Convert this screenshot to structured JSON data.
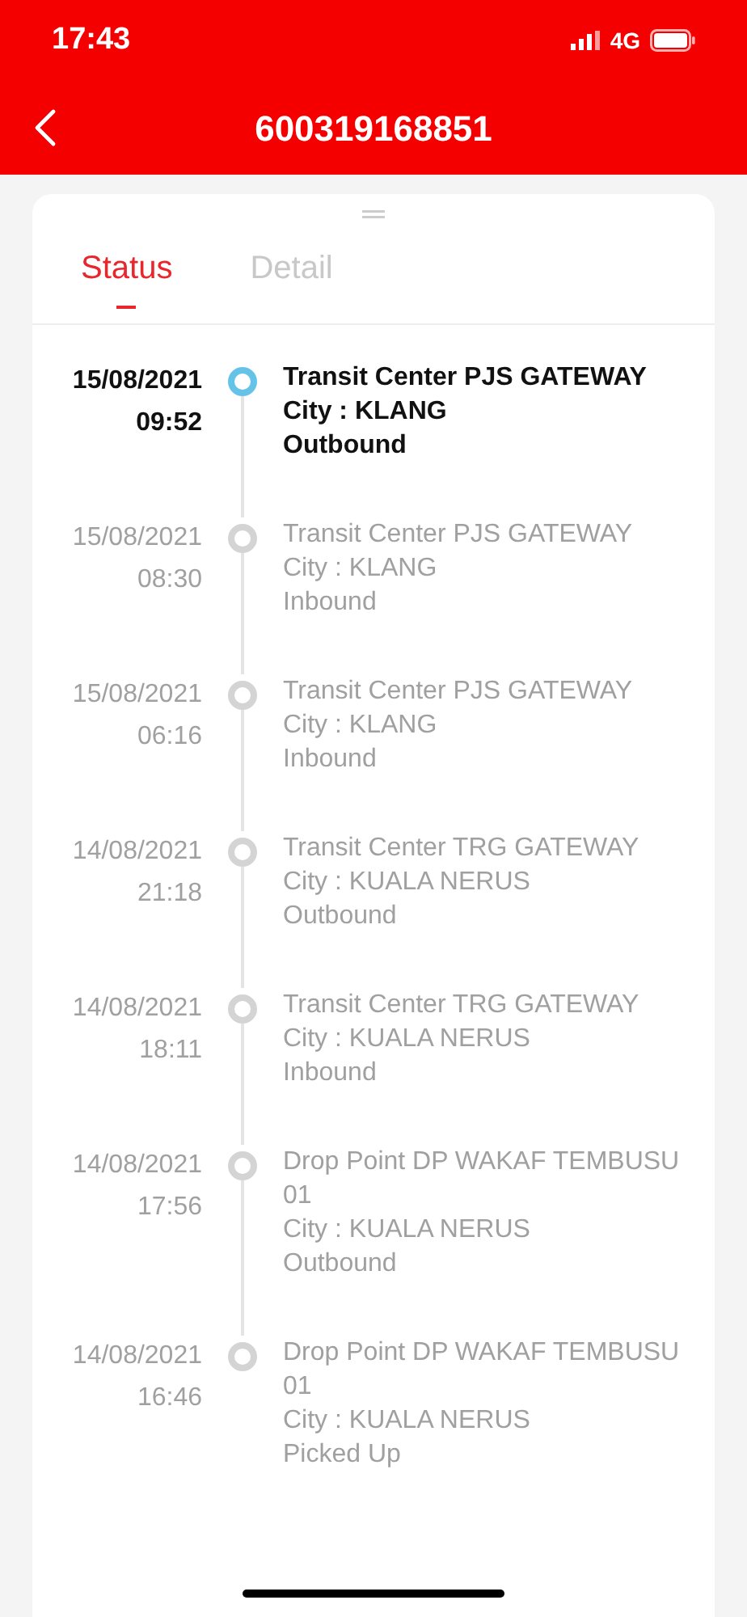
{
  "status_bar": {
    "time": "17:43",
    "network": "4G"
  },
  "header": {
    "title": "600319168851"
  },
  "tabs": [
    {
      "label": "Status",
      "selected": true
    },
    {
      "label": "Detail",
      "selected": false
    }
  ],
  "events": [
    {
      "date": "15/08/2021",
      "time": "09:52",
      "lines": [
        "Transit Center PJS GATEWAY",
        "City : KLANG",
        "Outbound"
      ],
      "current": true
    },
    {
      "date": "15/08/2021",
      "time": "08:30",
      "lines": [
        "Transit Center PJS GATEWAY",
        "City : KLANG",
        "Inbound"
      ],
      "current": false
    },
    {
      "date": "15/08/2021",
      "time": "06:16",
      "lines": [
        "Transit Center PJS GATEWAY",
        "City : KLANG",
        "Inbound"
      ],
      "current": false
    },
    {
      "date": "14/08/2021",
      "time": "21:18",
      "lines": [
        "Transit Center TRG GATEWAY",
        "City : KUALA NERUS",
        "Outbound"
      ],
      "current": false
    },
    {
      "date": "14/08/2021",
      "time": "18:11",
      "lines": [
        "Transit Center TRG GATEWAY",
        "City : KUALA NERUS",
        "Inbound"
      ],
      "current": false
    },
    {
      "date": "14/08/2021",
      "time": "17:56",
      "lines": [
        "Drop Point DP WAKAF TEMBUSU 01",
        "City : KUALA NERUS",
        "Outbound"
      ],
      "current": false
    },
    {
      "date": "14/08/2021",
      "time": "16:46",
      "lines": [
        "Drop Point DP WAKAF TEMBUSU 01",
        "City : KUALA NERUS",
        "Picked Up"
      ],
      "current": false
    }
  ]
}
